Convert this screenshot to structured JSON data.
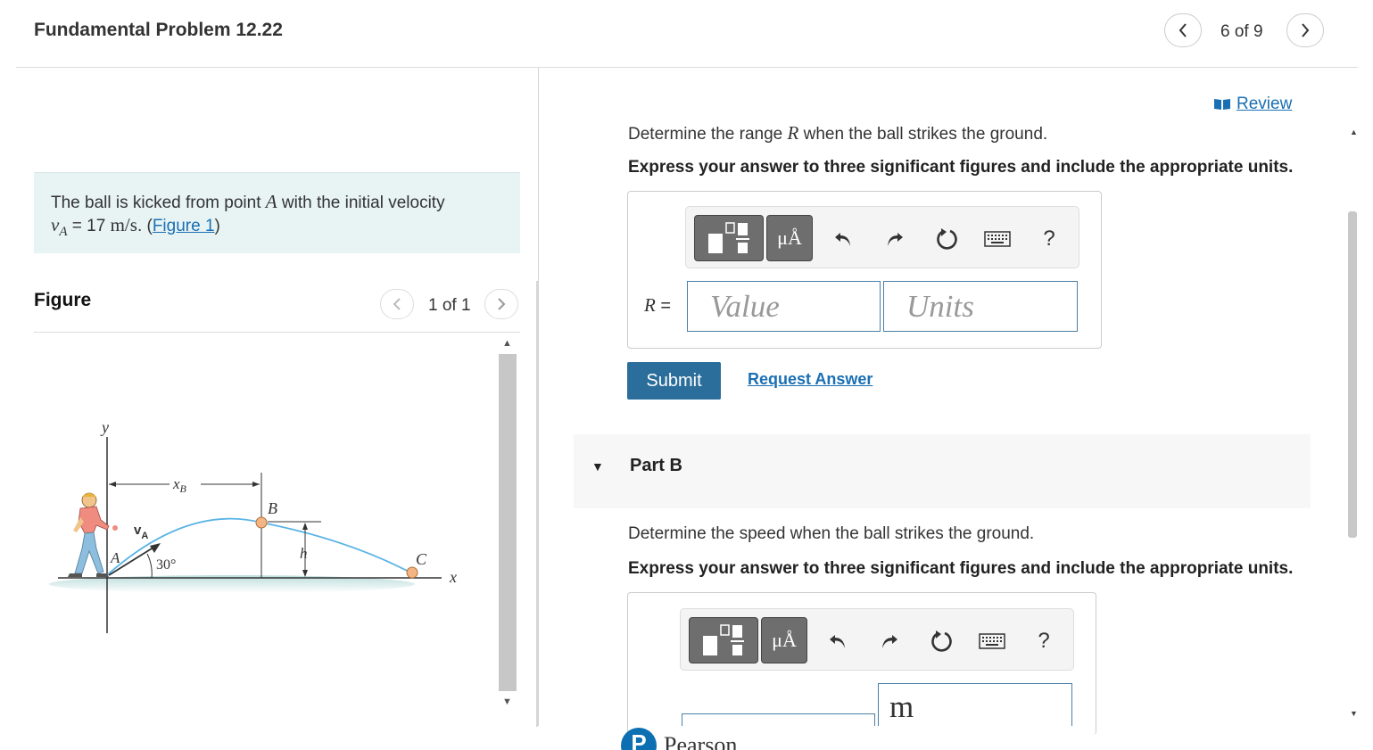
{
  "header": {
    "title": "Fundamental Problem 12.22",
    "prev_icon": "chevron-left-icon",
    "next_icon": "chevron-right-icon",
    "page_count": "6 of 9"
  },
  "intro": {
    "text_before": "The ball is kicked from point",
    "point": "A",
    "text_middle": "with the initial velocity",
    "velocity_symbol": "v",
    "velocity_sub": "A",
    "equals": "=",
    "velocity_value": "17",
    "velocity_unit": "m/s",
    "period_paren": ". (",
    "figure_link": "Figure 1",
    "close_paren": ")"
  },
  "figure": {
    "label": "Figure",
    "count": "1 of 1",
    "labels": {
      "y": "y",
      "xb": "x",
      "xb_sub": "B",
      "b": "B",
      "va": "v",
      "va_sub": "A",
      "a": "A",
      "angle": "30°",
      "h": "h",
      "c": "C",
      "x": "x"
    }
  },
  "review": {
    "label": "Review",
    "icon": "book-icon"
  },
  "part_a": {
    "question_before": "Determine the range",
    "question_var": "R",
    "question_after": "when the ball strikes the ground.",
    "instruction": "Express your answer to three significant figures and include the appropriate units.",
    "answer_label_var": "R",
    "answer_label_eq": "=",
    "value_placeholder": "Value",
    "units_placeholder": "Units",
    "submit": "Submit",
    "request_answer": "Request Answer"
  },
  "toolbar": {
    "mu_label": "μÅ",
    "help": "?"
  },
  "part_b": {
    "label": "Part B",
    "question": "Determine the speed when the ball strikes the ground.",
    "instruction": "Express your answer to three significant figures and include the appropriate units.",
    "units_value": "m"
  },
  "footer": {
    "brand": "Pearson",
    "logo_letter": "P"
  }
}
